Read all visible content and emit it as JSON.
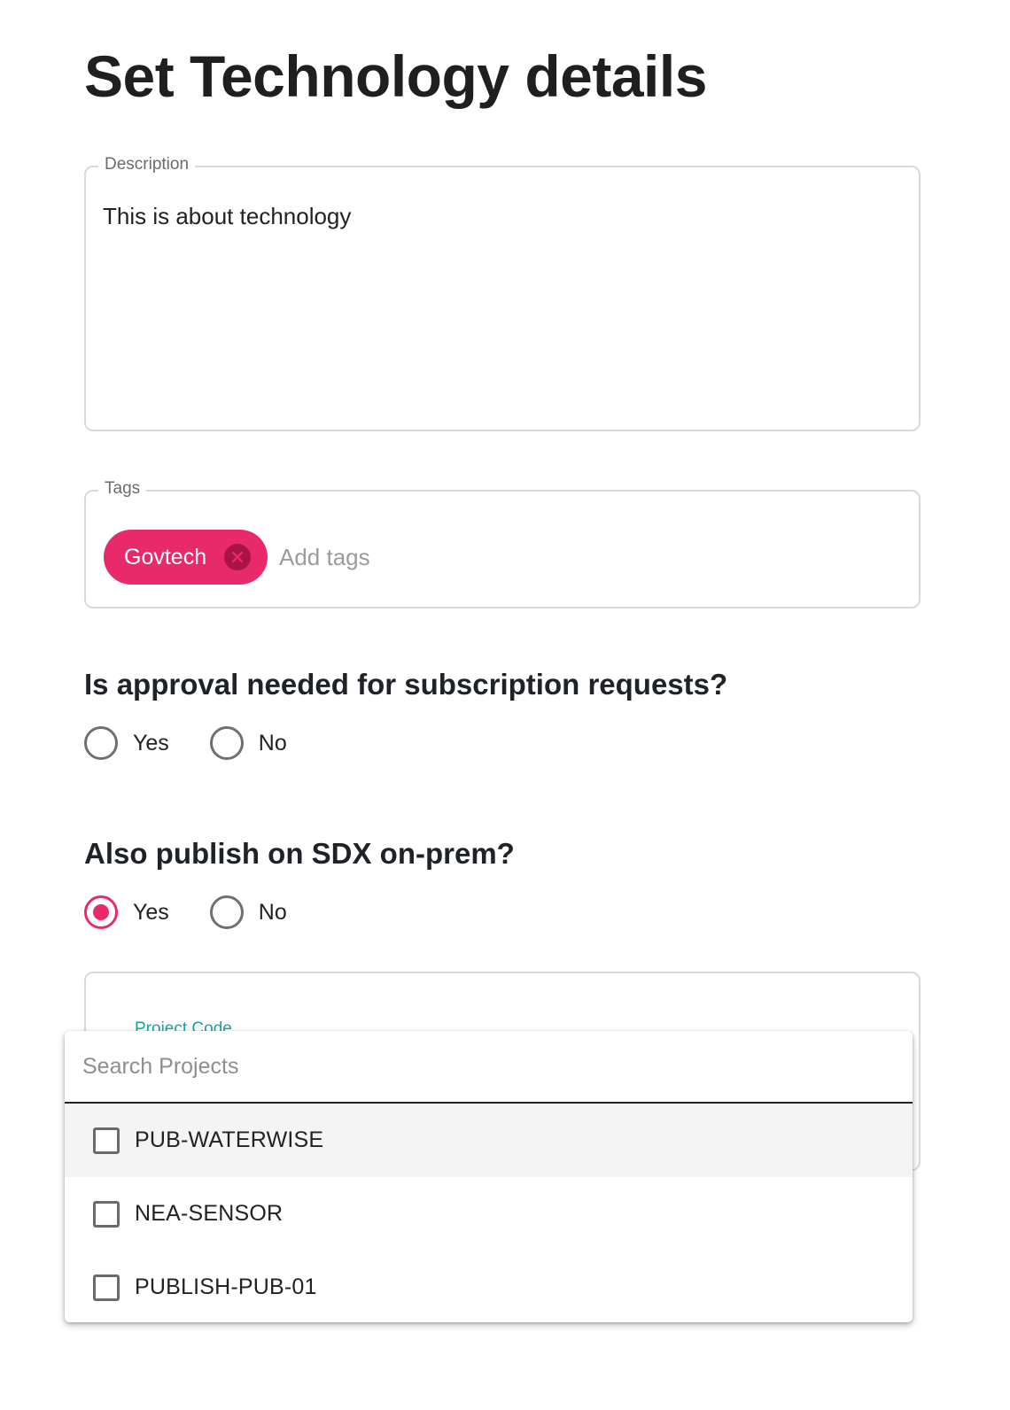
{
  "page": {
    "title": "Set Technology details"
  },
  "description": {
    "label": "Description",
    "value": "This is about technology"
  },
  "tags": {
    "label": "Tags",
    "chips": [
      {
        "label": "Govtech"
      }
    ],
    "placeholder": "Add tags"
  },
  "approval": {
    "question": "Is approval needed for subscription requests?",
    "options": [
      {
        "label": "Yes",
        "checked": false
      },
      {
        "label": "No",
        "checked": false
      }
    ]
  },
  "publish": {
    "question": "Also publish on SDX on-prem?",
    "options": [
      {
        "label": "Yes",
        "checked": true
      },
      {
        "label": "No",
        "checked": false
      }
    ]
  },
  "project": {
    "field_label": "Project Code",
    "search_placeholder": "Search Projects",
    "options": [
      {
        "label": "PUB-WATERWISE",
        "checked": false,
        "highlighted": true
      },
      {
        "label": "NEA-SENSOR",
        "checked": false,
        "highlighted": false
      },
      {
        "label": "PUBLISH-PUB-01",
        "checked": false,
        "highlighted": false
      }
    ]
  },
  "colors": {
    "accent": "#e8296a",
    "chip_remove": "#a81447",
    "teal_label": "#17a2a0"
  }
}
